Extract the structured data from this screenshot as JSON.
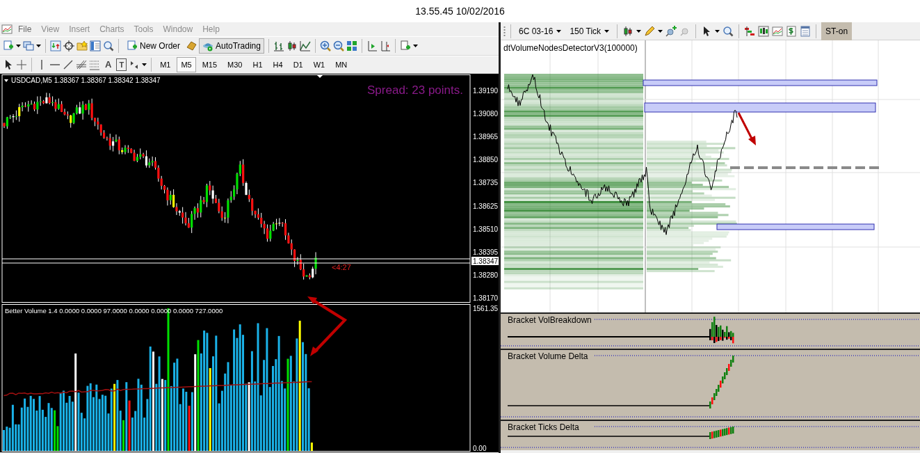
{
  "title_bar": {
    "time": "13.55.45 10/02/2016"
  },
  "terminal": {
    "menu": [
      {
        "label": "File"
      },
      {
        "label": "View"
      },
      {
        "label": "Insert"
      },
      {
        "label": "Charts"
      },
      {
        "label": "Tools"
      },
      {
        "label": "Window"
      },
      {
        "label": "Help"
      }
    ],
    "toolbar_buttons": [
      {
        "label": "New Order",
        "selected": false
      },
      {
        "label": "AutoTrading",
        "selected": true
      }
    ],
    "text_tools": [
      {
        "label": "A",
        "boxed": false
      },
      {
        "label": "T",
        "boxed": true
      }
    ],
    "timeframes": [
      {
        "label": "M1",
        "selected": false
      },
      {
        "label": "M5",
        "selected": true
      },
      {
        "label": "M15",
        "selected": false
      },
      {
        "label": "M30",
        "selected": false
      },
      {
        "label": "H1",
        "selected": false
      },
      {
        "label": "H4",
        "selected": false
      },
      {
        "label": "D1",
        "selected": false
      },
      {
        "label": "W1",
        "selected": false
      },
      {
        "label": "MN",
        "selected": false
      }
    ],
    "price_chart": {
      "title": "USDCAD,M5  1.38367 1.38367 1.38342 1.38347",
      "spread": "Spread: 23 points.",
      "countdown": "<4:27",
      "axis_labels": [
        "1.39190",
        "1.39080",
        "1.38965",
        "1.38850",
        "1.38735",
        "1.38625",
        "1.38510",
        "1.38395",
        "1.38280",
        "1.38170"
      ],
      "current_price": "1.38347"
    },
    "volume_chart": {
      "title": "Better Volume 1.4 0.0000 0.0000 97.0000 0.0000 0.0000 0.0000 727.0000",
      "axis_labels": [
        "1561.35",
        "0.00"
      ]
    }
  },
  "ninjatrader": {
    "instrument": "6C 03-16",
    "interval": "150 Tick",
    "strategy_button": {
      "label": "ST-on",
      "selected": true
    },
    "chart_label": "dtVolumeNodesDetectorV3(100000)",
    "panels": [
      {
        "title": "Bracket VolBreakdown",
        "kind": "breakdown"
      },
      {
        "title": "Bracket Volume Delta",
        "kind": "delta"
      },
      {
        "title": "Bracket Ticks Delta",
        "kind": "delta"
      }
    ]
  }
}
